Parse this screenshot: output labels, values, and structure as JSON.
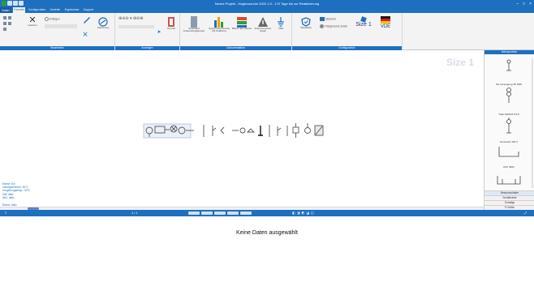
{
  "window": {
    "title": "Neues Projekt - Hagercad.sim 2022 1.0 - 170 Tage bis zur Reaktivierung"
  },
  "ribbon": {
    "file_tab": "Datei",
    "tabs": [
      "Formeln",
      "Konfiguration",
      "Verteiler",
      "Ergebnisse",
      "Support"
    ],
    "active_tab": 0,
    "groups": {
      "bearbeiten": {
        "label": "Bearbeiten",
        "delete_label": "Löschen",
        "paste_label": "Einfügen",
        "unit_label": "Einheiten hinzufügen",
        "drawing_label": "Zeichnung"
      },
      "anzeigen": {
        "label": "Anzeigen",
        "zoom_label": "Zoom",
        "default_label": "Normal"
      },
      "dokumentation": {
        "label": "Dokumentation",
        "btn1": "Schriftfeld Anwendungsfenster",
        "btn2": "Systemberechnung Mit Teilabzug",
        "btn3": "Bilanz des Netzes",
        "btn4": "Drehmomenten Haupt",
        "btn5": "VDE"
      },
      "konfiguration": {
        "label": "Konfiguration",
        "btn1": "Standards",
        "btn2": "Standard",
        "btn3": "Fristgerechte Zeiten",
        "size_label": "Size 1",
        "vde_label": "VDE"
      }
    }
  },
  "canvas": {
    "size_watermark": "Size 1",
    "layer_info": [
      "Ebene: Ein",
      "Leitungsrechner: 30°C",
      "Umgebungstemp.: 30°C",
      "Zeit: aktiv",
      "AbC: aktiv"
    ],
    "status_text": "Ebene: Aktiv"
  },
  "right_panel": {
    "header": "Netzsymbole",
    "symbols": [
      {
        "label": ""
      },
      {
        "label": "NS Versorgung 3P PEN"
      },
      {
        "label": ""
      },
      {
        "label": "Trafo 630kVA TN-S"
      },
      {
        "label": ""
      },
      {
        "label": "Generator 400 V"
      },
      {
        "label": "USV 400V"
      },
      {
        "label": ""
      }
    ],
    "buttons": [
      "Netzumschalter",
      "Schaltkreise",
      "Sonstige",
      "FI Zellen"
    ]
  },
  "midbar": {
    "left_label": "≡",
    "center_label": "1 / 1"
  },
  "bottom_pane": {
    "empty_message": "Keine Daten ausgewählt"
  },
  "colors": {
    "brand": "#1e6fc0",
    "ribbon_bg": "#f3f3f3",
    "flag_black": "#1a1a1a",
    "flag_red": "#d62020",
    "flag_gold": "#f2c200"
  }
}
